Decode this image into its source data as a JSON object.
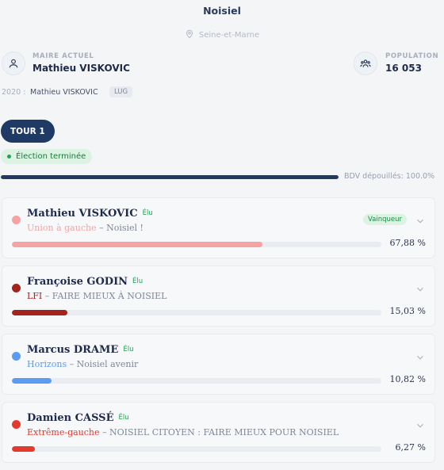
{
  "header": {
    "city": "Noisiel",
    "department": "Seine-et-Marne"
  },
  "mayor": {
    "label": "MAIRE ACTUEL",
    "name": "Mathieu VISKOVIC"
  },
  "population": {
    "label": "POPULATION",
    "value": "16 053"
  },
  "previous": {
    "year": "2020 :",
    "name": "Mathieu VISKOVIC",
    "badge": "LUG"
  },
  "round": {
    "tab_label": "TOUR 1",
    "status": "Élection terminée",
    "bdv_text": "BDV dépouillés: 100.0%",
    "bdv_fraction": 1.0
  },
  "candidates": [
    {
      "name": "Mathieu VISKOVIC",
      "elected_label": "Élu",
      "party": "Union à gauche",
      "list": "Noisiel !",
      "percent_text": "67,88 %",
      "percent": 67.88,
      "color": "#f5a3a3",
      "winner_label": "Vainqueur"
    },
    {
      "name": "Françoise GODIN",
      "elected_label": "Élu",
      "party": "LFI",
      "list": "FAIRE MIEUX À NOISIEL",
      "percent_text": "15,03 %",
      "percent": 15.03,
      "color": "#a3231f"
    },
    {
      "name": "Marcus DRAME",
      "elected_label": "Élu",
      "party": "Horizons",
      "list": "Noisiel avenir",
      "percent_text": "10,82 %",
      "percent": 10.82,
      "color": "#5b9cf0"
    },
    {
      "name": "Damien CASSÉ",
      "elected_label": "Élu",
      "party": "Extrême-gauche",
      "list": "NOISIEL CITOYEN : FAIRE MIEUX POUR NOISIEL",
      "percent_text": "6,27 %",
      "percent": 6.27,
      "color": "#e23b2e"
    }
  ],
  "separator": " – "
}
